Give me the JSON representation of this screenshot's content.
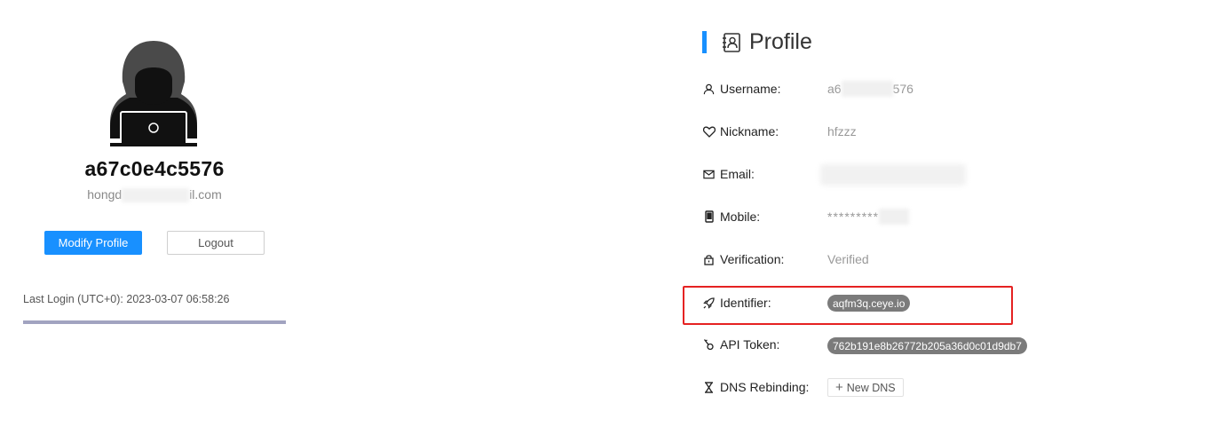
{
  "user": {
    "display_name": "a67c0e4c5576",
    "email_prefix": "hongd",
    "email_suffix": "il.com"
  },
  "buttons": {
    "modify": "Modify Profile",
    "logout": "Logout"
  },
  "last_login": "Last Login (UTC+0): 2023-03-07 06:58:26",
  "profile": {
    "title": "Profile",
    "fields": {
      "username": {
        "label": "Username:",
        "value_prefix": "a6",
        "value_suffix": "576",
        "icon": "user-icon"
      },
      "nickname": {
        "label": "Nickname:",
        "value": "hfzzz",
        "icon": "heart-icon"
      },
      "email": {
        "label": "Email:",
        "icon": "mail-icon"
      },
      "mobile": {
        "label": "Mobile:",
        "value": "*********",
        "icon": "mobile-icon"
      },
      "verification": {
        "label": "Verification:",
        "value": "Verified",
        "icon": "lock-icon"
      },
      "identifier": {
        "label": "Identifier:",
        "value": "aqfm3q.ceye.io",
        "icon": "rocket-icon"
      },
      "api_token": {
        "label": "API Token:",
        "value": "762b191e8b26772b205a36d0c01d9db7",
        "icon": "key-icon"
      },
      "dns_rebinding": {
        "label": "DNS Rebinding:",
        "button": "New DNS",
        "icon": "hourglass-icon"
      }
    }
  },
  "colors": {
    "primary": "#1890ff",
    "highlight": "#e52222",
    "tag_bg": "#7b7b7b",
    "divider": "#a1a3c0"
  }
}
